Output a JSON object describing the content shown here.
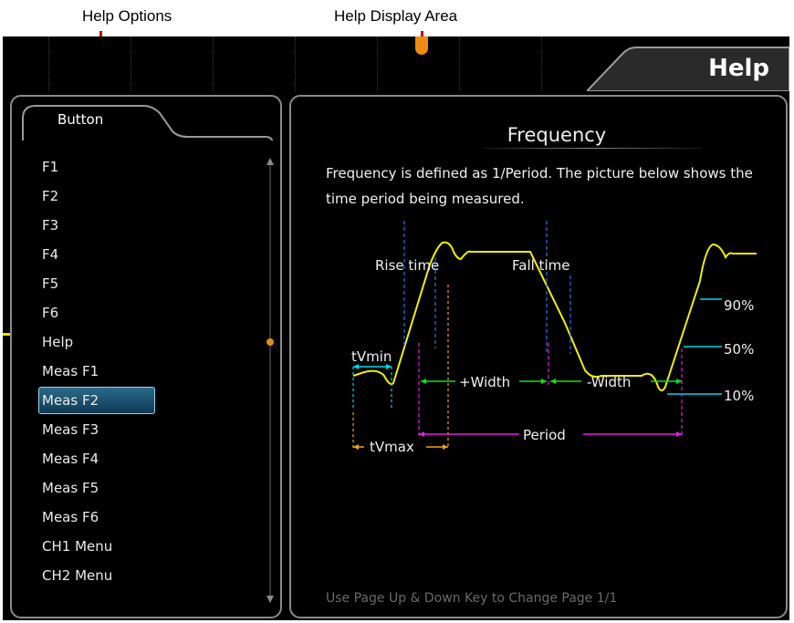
{
  "annotations": {
    "help_options": "Help Options",
    "help_display_area": "Help Display Area"
  },
  "window": {
    "title": "Help"
  },
  "tab": {
    "label": "Button"
  },
  "menu_items": [
    "F1",
    "F2",
    "F3",
    "F4",
    "F5",
    "F6",
    "Help",
    "Meas F1",
    "Meas F2",
    "Meas F3",
    "Meas F4",
    "Meas F5",
    "Meas F6",
    "CH1 Menu",
    "CH2 Menu"
  ],
  "selected_item": "Meas F2",
  "content": {
    "title": "Frequency",
    "description": "Frequency is defined as 1/Period. The picture below shows the time period being measured.",
    "diagram_labels": {
      "rise_time": "Rise time",
      "fall_time": "Fall time",
      "p90": "90%",
      "p50": "50%",
      "p10": "10%",
      "tvmin": "tVmin",
      "tvmax": "tVmax",
      "plus_width": "+Width",
      "minus_width": "-Width",
      "period": "Period"
    },
    "footer": "Use Page Up & Down Key to Change Page  1/1"
  },
  "colors": {
    "waveform": "#f0f000",
    "cyan": "#00d8e8",
    "magenta": "#e020e0",
    "green": "#10e010",
    "orange": "#f0a020",
    "blue": "#3070f0",
    "annotation_arrow": "#c80000",
    "selected_item_bg": "#1f5575"
  },
  "icons": {
    "scroll_up": "up-arrow-icon",
    "scroll_down": "down-arrow-icon",
    "scroll_thumb": "dot-icon",
    "trigger_marker": "trigger-marker-icon",
    "channel_marker": "channel-marker-icon"
  }
}
